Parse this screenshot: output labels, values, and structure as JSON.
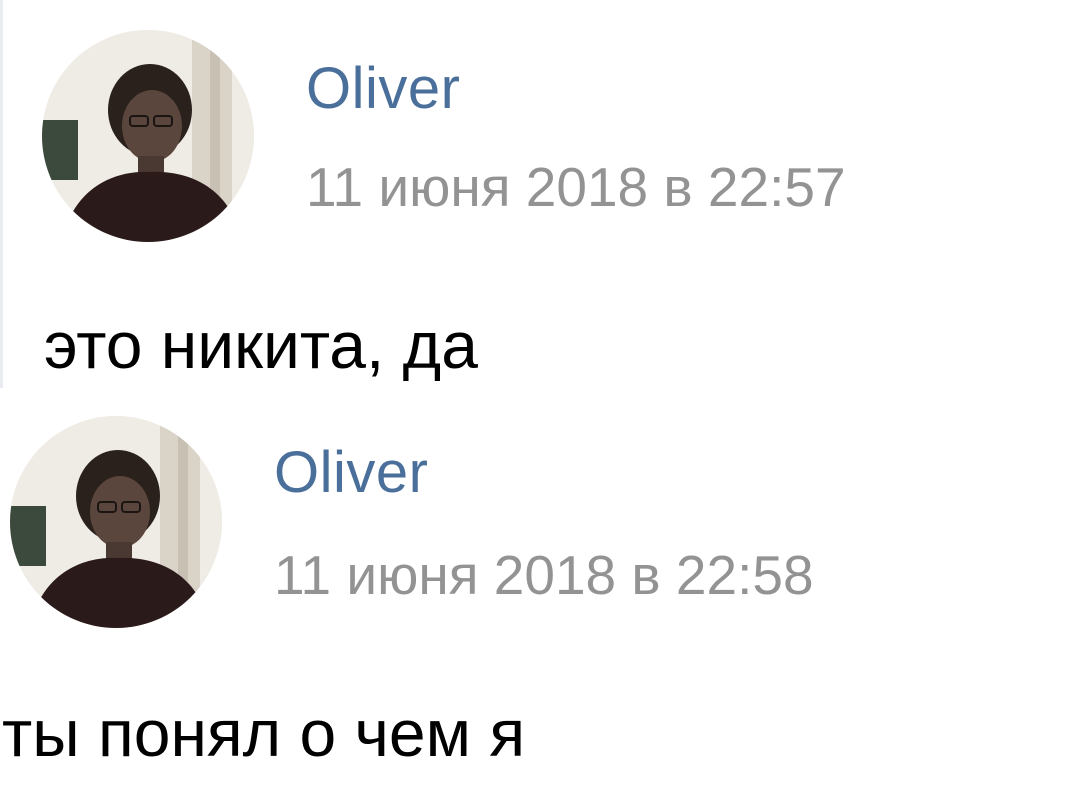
{
  "posts": [
    {
      "author": "Oliver",
      "date": "11 июня 2018 в 22:57",
      "text": "это никита, да",
      "avatar_icon": "user-photo-avatar"
    },
    {
      "author": "Oliver",
      "date": "11 июня 2018 в 22:58",
      "text": "ты понял о чем я",
      "avatar_icon": "user-photo-avatar"
    }
  ],
  "colors": {
    "author_link": "#4a6f9a",
    "date_text": "#939393",
    "message_text": "#000000",
    "background": "#ffffff"
  }
}
